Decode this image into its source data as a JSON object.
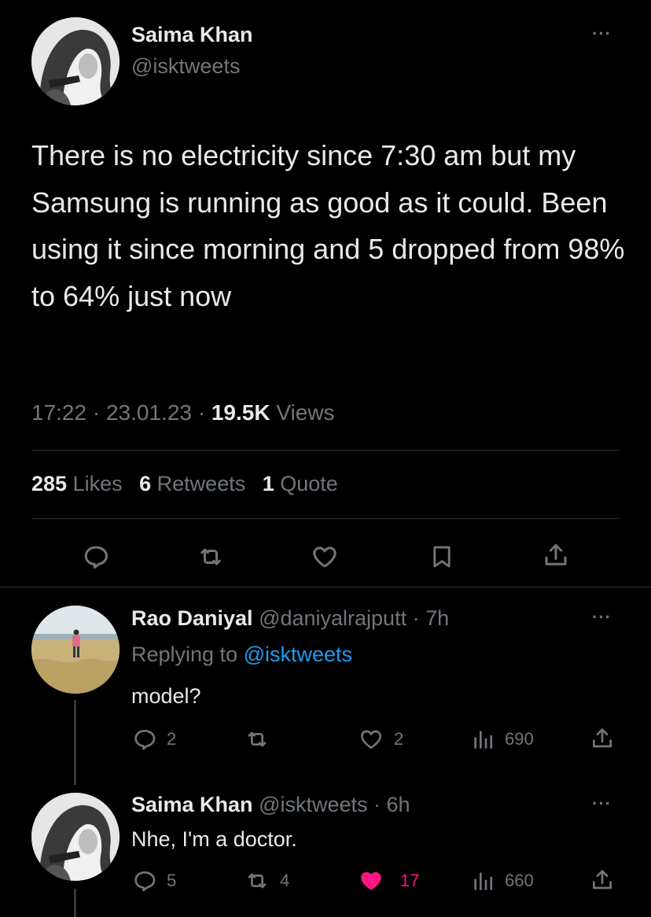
{
  "main_tweet": {
    "name": "Saima Khan",
    "handle": "@isktweets",
    "more": "···",
    "text": "There is no electricity since 7:30 am but my Samsung is running as good as it could. Been using it since morning and 5 dropped from 98% to 64% just now",
    "time": "17:22",
    "sep1": " · ",
    "date": "23.01.23",
    "sep2": " · ",
    "views_count": "19.5K",
    "views_label": " Views",
    "likes_count": "285",
    "likes_label": " Likes",
    "retweets_count": "6",
    "retweets_label": " Retweets",
    "quotes_count": "1",
    "quotes_label": " Quote",
    "actions": [
      "reply-icon",
      "retweet-icon",
      "like-icon",
      "bookmark-icon",
      "share-icon"
    ]
  },
  "replies": [
    {
      "name": "Rao Daniyal",
      "handle": " @daniyalrajputt",
      "time": " · 7h",
      "more": "···",
      "replying_prefix": "Replying to ",
      "replying_to": "@isktweets",
      "text": "model?",
      "reply_count": "2",
      "retweet_count": "",
      "like_count": "2",
      "view_count": "690",
      "liked": false
    },
    {
      "name": "Saima Khan",
      "handle": " @isktweets",
      "time": " · 6h",
      "more": "···",
      "text": "Nhe, I'm a doctor.",
      "reply_count": "5",
      "retweet_count": "4",
      "like_count": "17",
      "view_count": "660",
      "liked": true
    }
  ],
  "colors": {
    "background": "#000000",
    "text_primary": "#e7e9ea",
    "text_secondary": "#71767b",
    "link": "#1d9bf0",
    "like_active": "#f91880",
    "divider": "#2f3336"
  }
}
